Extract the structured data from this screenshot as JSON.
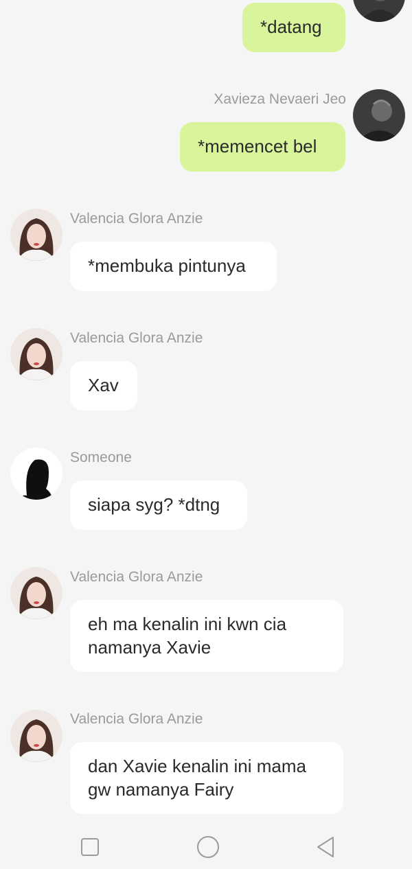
{
  "messages": [
    {
      "sender": "",
      "text": "*datang",
      "mine": true
    },
    {
      "sender": "Xavieza Nevaeri Jeo",
      "text": "*memencet bel",
      "mine": true
    },
    {
      "sender": "Valencia Glora Anzie",
      "text": "*membuka pintunya",
      "mine": false
    },
    {
      "sender": "Valencia Glora Anzie",
      "text": "Xav",
      "mine": false
    },
    {
      "sender": "Someone",
      "text": "siapa syg? *dtng",
      "mine": false
    },
    {
      "sender": "Valencia Glora Anzie",
      "text": "eh ma kenalin ini kwn cia namanya Xavie",
      "mine": false
    },
    {
      "sender": "Valencia Glora Anzie",
      "text": "dan Xavie kenalin ini mama gw namanya Fairy",
      "mine": false
    }
  ],
  "colors": {
    "background": "#f5f5f5",
    "mine_bubble": "#d8f59b",
    "other_bubble": "#ffffff",
    "sender_name": "#9a9a9a"
  },
  "navbar": {
    "icons": [
      "square-recent-apps-icon",
      "circle-home-icon",
      "triangle-back-icon"
    ]
  }
}
